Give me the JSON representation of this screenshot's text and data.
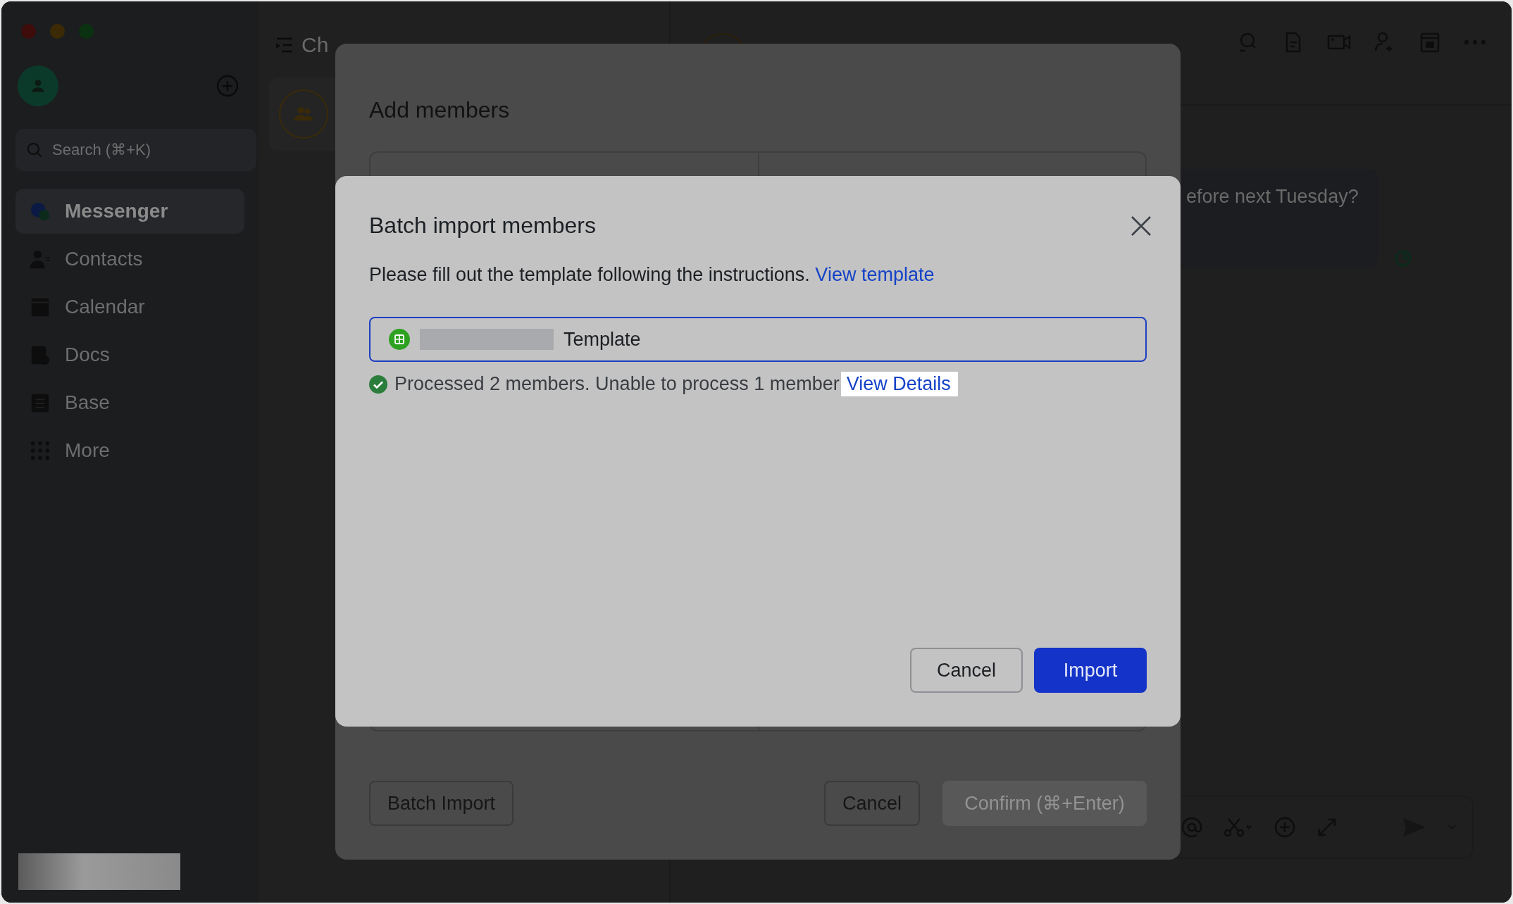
{
  "sidebar": {
    "search": {
      "placeholder": "Search (⌘+K)"
    },
    "items": [
      {
        "label": "Messenger",
        "selected": true
      },
      {
        "label": "Contacts",
        "selected": false
      },
      {
        "label": "Calendar",
        "selected": false
      },
      {
        "label": "Docs",
        "selected": false
      },
      {
        "label": "Base",
        "selected": false
      },
      {
        "label": "More",
        "selected": false
      }
    ]
  },
  "chat_list": {
    "title": "Ch"
  },
  "chat": {
    "message": "efore next Tuesday?"
  },
  "add_members": {
    "title": "Add members",
    "buttons": [
      {
        "label": "Batch Import",
        "kind": "secondary",
        "disabled": false
      },
      {
        "label": "Cancel",
        "kind": "secondary",
        "disabled": false
      },
      {
        "label": "Confirm (⌘+Enter)",
        "kind": "primary",
        "disabled": true
      }
    ]
  },
  "batch_import": {
    "title": "Batch import members",
    "instruction": "Please fill out the template following the instructions.",
    "link": "View template",
    "file": {
      "value": "Template"
    },
    "status": {
      "text": "Processed 2 members. Unable to process 1 member",
      "link": "View Details"
    },
    "buttons": [
      {
        "label": "Cancel",
        "kind": "secondary"
      },
      {
        "label": "Import",
        "kind": "primary"
      }
    ]
  }
}
